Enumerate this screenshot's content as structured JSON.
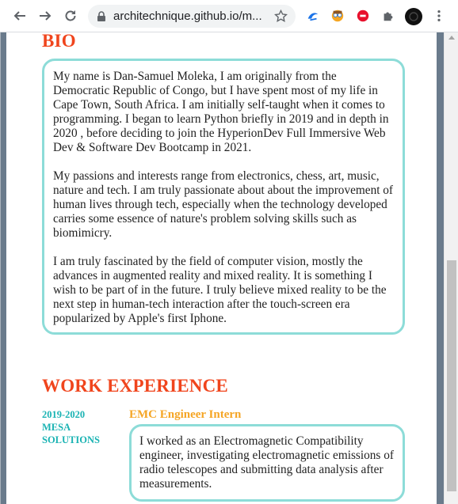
{
  "browser": {
    "url": "architechnique.github.io/m...",
    "back_icon": "arrow-left",
    "forward_icon": "arrow-right",
    "reload_icon": "reload",
    "lock_icon": "lock",
    "bookmark_icon": "star-outline",
    "extensions": [
      "blue-swirl-extension",
      "avatar-extension",
      "red-record-extension",
      "puzzle-extensions-icon",
      "profile-avatar"
    ],
    "menu_icon": "kebab-menu"
  },
  "bio": {
    "heading": "BIO",
    "paragraphs": [
      "My name is Dan-Samuel Moleka, I am originally from the Democratic Republic of Congo, but I have spent most of my life in Cape Town, South Africa. I am initially self-taught when it comes to programming. I began to learn Python briefly in 2019 and in depth in 2020 , before deciding to join the HyperionDev Full Immersive Web Dev & Software Dev Bootcamp in 2021.",
      "My passions and interests range from electronics, chess, art, music, nature and tech. I am truly passionate about about the improvement of human lives through tech, especially when the technology developed carries some essence of nature's problem solving skills such as biomimicry.",
      "I am truly fascinated by the field of computer vision, mostly the advances in augmented reality and mixed reality. It is something I wish to be part of in the future. I truly believe mixed reality to be the next step in human-tech interaction after the touch-screen era popularized by Apple's first Iphone."
    ]
  },
  "work": {
    "heading": "WORK EXPERIENCE",
    "jobs": [
      {
        "date": "2019-2020",
        "company_line1": "MESA",
        "company_line2": "SOLUTIONS",
        "title": "EMC Engineer Intern",
        "description": "I worked as an Electromagnetic Compatibility engineer, investigating electromagnetic emissions of radio telescopes and submitting data analysis after measurements."
      }
    ]
  },
  "colors": {
    "heading": "#f0451d",
    "border": "#8ddcd8",
    "date": "#1ab3b3",
    "job_title": "#f5a524",
    "stripe": "#6a7b8c"
  }
}
